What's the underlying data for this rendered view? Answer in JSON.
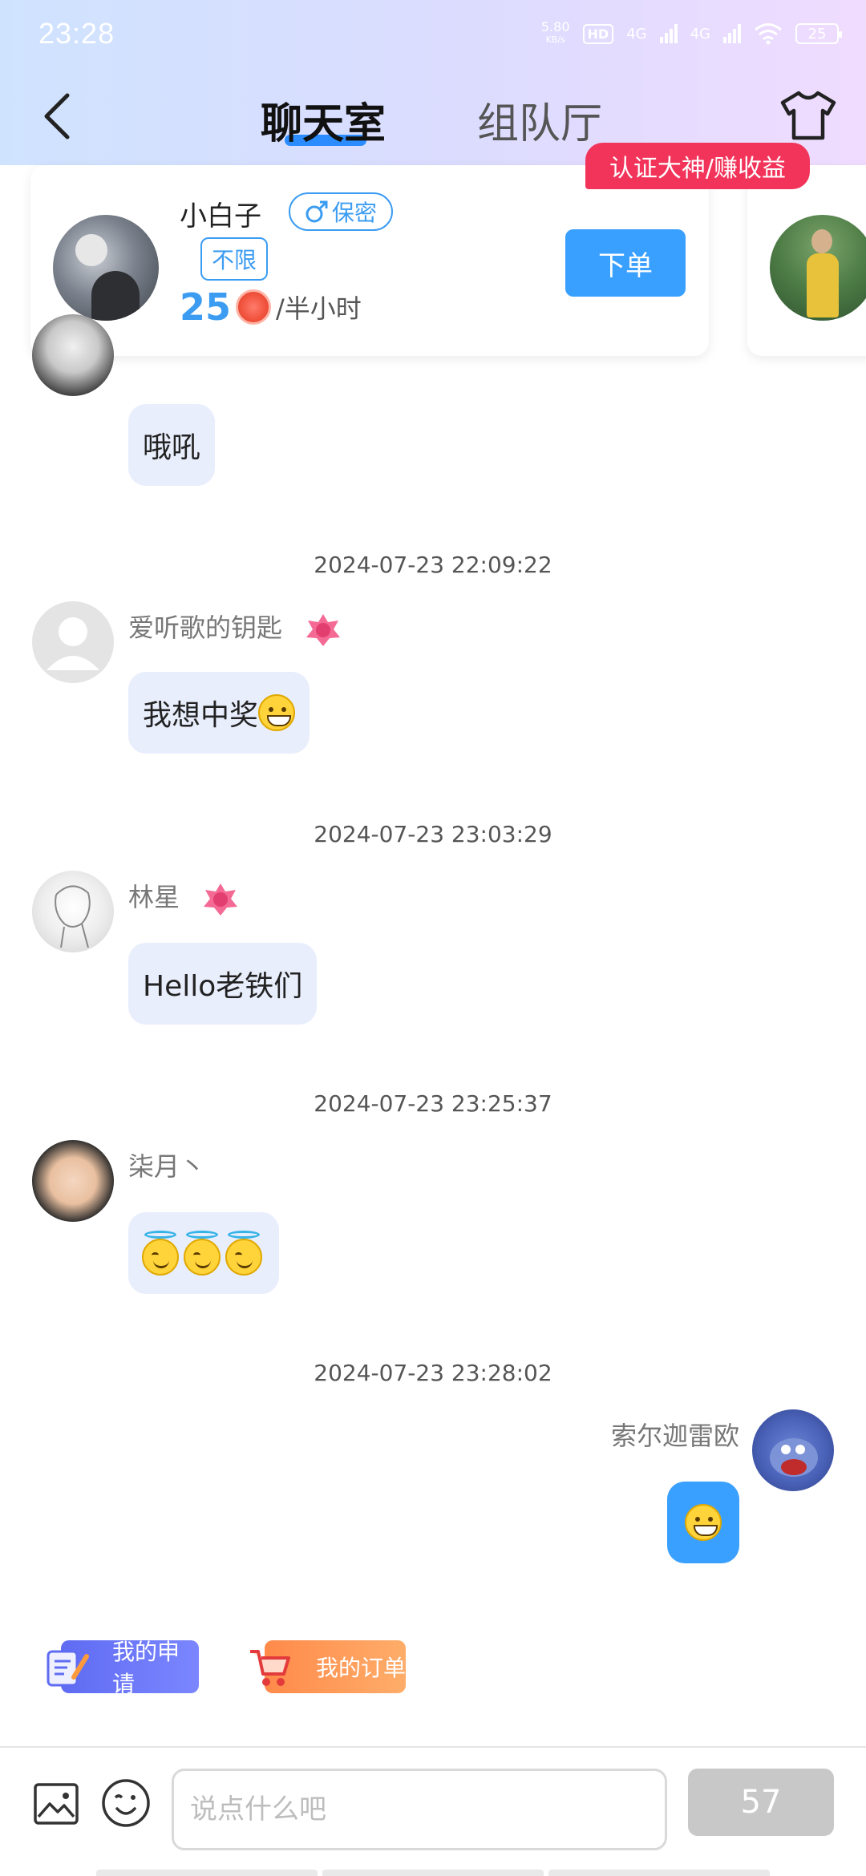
{
  "status_bar": {
    "time": "23:28",
    "net_speed_value": "5.80",
    "net_speed_unit": "KB/s",
    "hd_label": "HD",
    "sim1": "4G",
    "sim2": "4G",
    "battery": "25"
  },
  "nav": {
    "tabs": [
      {
        "label": "聊天室",
        "active": true
      },
      {
        "label": "组队厅",
        "active": false
      }
    ]
  },
  "promo": {
    "label": "认证大神/赚收益"
  },
  "host_card": {
    "name": "小白子",
    "gender_label": "保密",
    "limit_tag": "不限",
    "price": "25",
    "price_unit": "/半小时",
    "order_button": "下单"
  },
  "messages": [
    {
      "type": "message",
      "nickname": "",
      "text": "哦吼",
      "side": "left"
    },
    {
      "type": "time",
      "text": "2024-07-23 22:09:22"
    },
    {
      "type": "message",
      "nickname": "爱听歌的钥匙",
      "text": "我想中奖",
      "side": "left"
    },
    {
      "type": "time",
      "text": "2024-07-23 23:03:29"
    },
    {
      "type": "message",
      "nickname": "林星",
      "text": "Hello老铁们",
      "side": "left"
    },
    {
      "type": "time",
      "text": "2024-07-23 23:25:37"
    },
    {
      "type": "message",
      "nickname": "柒月丶",
      "text": "",
      "emojis": [
        "smiling-face-with-halo",
        "smiling-face-with-halo",
        "smiling-face-with-halo"
      ],
      "side": "left"
    },
    {
      "type": "time",
      "text": "2024-07-23 23:28:02"
    },
    {
      "type": "message",
      "nickname": "索尔迦雷欧",
      "text": "",
      "emojis": [
        "grinning-face"
      ],
      "side": "right"
    }
  ],
  "quick_actions": {
    "apply": "我的申请",
    "orders": "我的订单"
  },
  "input_bar": {
    "placeholder": "说点什么吧",
    "send_label": "57"
  },
  "colors": {
    "accent": "#3aa0ff",
    "promo": "#f2345a",
    "bubble_left": "#e9eefc",
    "bubble_right": "#3aa0ff"
  }
}
